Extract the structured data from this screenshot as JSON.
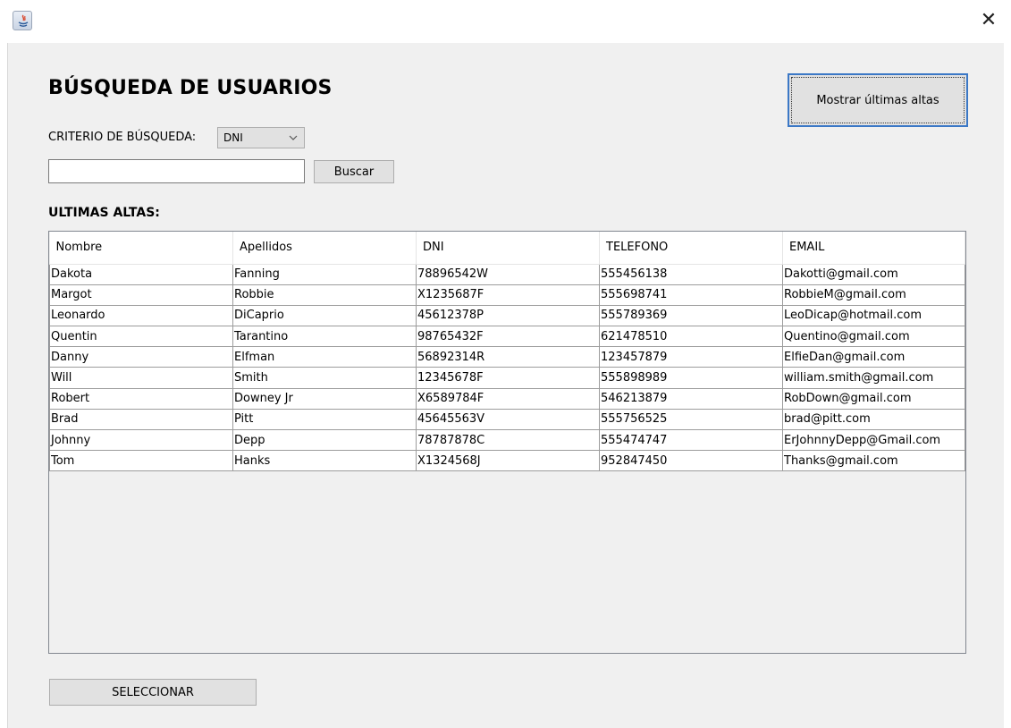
{
  "window": {
    "close_glyph": "✕"
  },
  "header": {
    "title": "BÚSQUEDA DE USUARIOS",
    "recent_button_label": "Mostrar últimas altas"
  },
  "search": {
    "criteria_label": "CRITERIO DE BÚSQUEDA:",
    "criteria_selected": "DNI",
    "input_value": "",
    "button_label": "Buscar"
  },
  "table": {
    "section_label": "ULTIMAS ALTAS:",
    "columns": [
      "Nombre",
      "Apellidos",
      "DNI",
      "TELEFONO",
      "EMAIL"
    ],
    "rows": [
      [
        "Dakota",
        "Fanning",
        "78896542W",
        "555456138",
        "Dakotti@gmail.com"
      ],
      [
        "Margot",
        "Robbie",
        "X1235687F",
        "555698741",
        "RobbieM@gmail.com"
      ],
      [
        "Leonardo",
        "DiCaprio",
        "45612378P",
        "555789369",
        "LeoDicap@hotmail.com"
      ],
      [
        "Quentin",
        "Tarantino",
        "98765432F",
        "621478510",
        "Quentino@gmail.com"
      ],
      [
        "Danny",
        "Elfman",
        "56892314R",
        "123457879",
        "ElfieDan@gmail.com"
      ],
      [
        "Will",
        "Smith",
        "12345678F",
        "555898989",
        "william.smith@gmail.com"
      ],
      [
        "Robert",
        "Downey Jr",
        "X6589784F",
        "546213879",
        "RobDown@gmail.com"
      ],
      [
        "Brad",
        "Pitt",
        "45645563V",
        "555756525",
        "brad@pitt.com"
      ],
      [
        "Johnny",
        "Depp",
        "78787878C",
        "555474747",
        "ErJohnnyDepp@Gmail.com"
      ],
      [
        "Tom",
        "Hanks",
        "X1324568J",
        "952847450",
        "Thanks@gmail.com"
      ]
    ]
  },
  "footer": {
    "select_button_label": "SELECCIONAR"
  },
  "colors": {
    "focus_border": "#3b78c6",
    "panel_background": "#f0f0f0",
    "button_background": "#e1e1e1"
  }
}
